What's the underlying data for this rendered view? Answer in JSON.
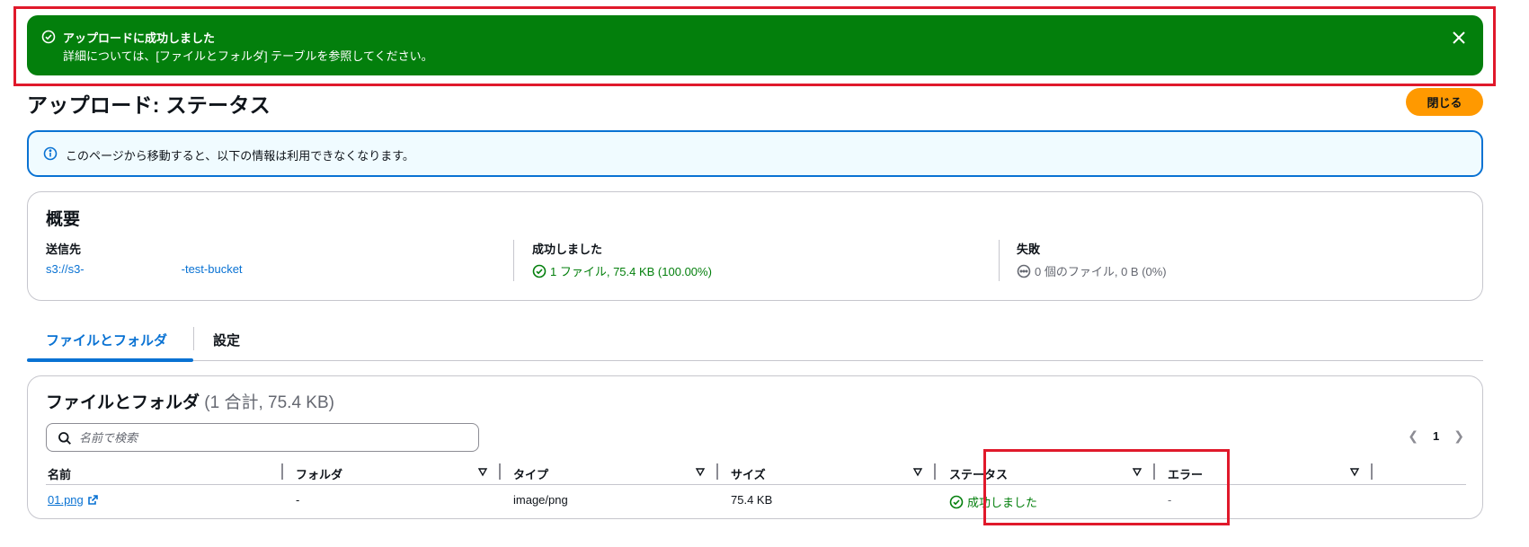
{
  "flash": {
    "title": "アップロードに成功しました",
    "message": "詳細については、[ファイルとフォルダ] テーブルを参照してください。"
  },
  "page": {
    "title": "アップロード: ステータス",
    "close_label": "閉じる"
  },
  "info": {
    "text": "このページから移動すると、以下の情報は利用できなくなります。"
  },
  "summary": {
    "heading": "概要",
    "destination": {
      "label": "送信先",
      "value_prefix": "s3://s3-",
      "value_suffix": "-test-bucket"
    },
    "succeeded": {
      "label": "成功しました",
      "value": "1 ファイル, 75.4 KB (100.00%)"
    },
    "failed": {
      "label": "失敗",
      "value": "0 個のファイル, 0 B (0%)"
    }
  },
  "tabs": [
    {
      "label": "ファイルとフォルダ",
      "active": true
    },
    {
      "label": "設定",
      "active": false
    }
  ],
  "files": {
    "heading": "ファイルとフォルダ",
    "count": "(1 合計, 75.4 KB)",
    "search_placeholder": "名前で検索",
    "page_number": "1",
    "columns": [
      "名前",
      "フォルダ",
      "タイプ",
      "サイズ",
      "ステータス",
      "エラー"
    ],
    "rows": [
      {
        "name": "01.png",
        "folder": "-",
        "type": "image/png",
        "size": "75.4 KB",
        "status": "成功しました",
        "error": "-"
      }
    ]
  },
  "colors": {
    "success": "#037f0c",
    "link": "#0972d3",
    "primary_button": "#ff9900",
    "info_bg": "#f0fbff",
    "annotation_red": "#e0192b"
  }
}
